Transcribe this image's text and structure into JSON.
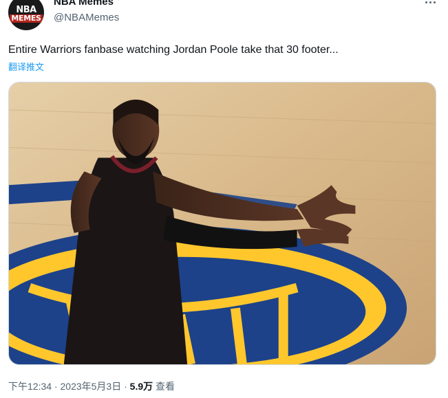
{
  "author": {
    "display_name": "NBA Memes",
    "handle": "@NBAMemes",
    "avatar_text_top": "NBA",
    "avatar_text_bottom": "MEMES"
  },
  "tweet": {
    "text": "Entire Warriors fanbase watching Jordan Poole take that 30 footer...",
    "translate_label": "翻译推文",
    "media_icon": "image-icon"
  },
  "meta": {
    "time": "下午12:34",
    "separator1": " · ",
    "date": "2023年5月3日",
    "separator2": " · ",
    "views_count": "5.9万",
    "views_label": " 查看"
  },
  "colors": {
    "link": "#1d9bf0",
    "secondary_text": "#536471",
    "primary_text": "#0f1419",
    "court_wood": "#d9b98c",
    "logo_blue": "#1d428a",
    "logo_yellow": "#ffc72c"
  },
  "icons": {
    "more": "more-dots-icon"
  }
}
